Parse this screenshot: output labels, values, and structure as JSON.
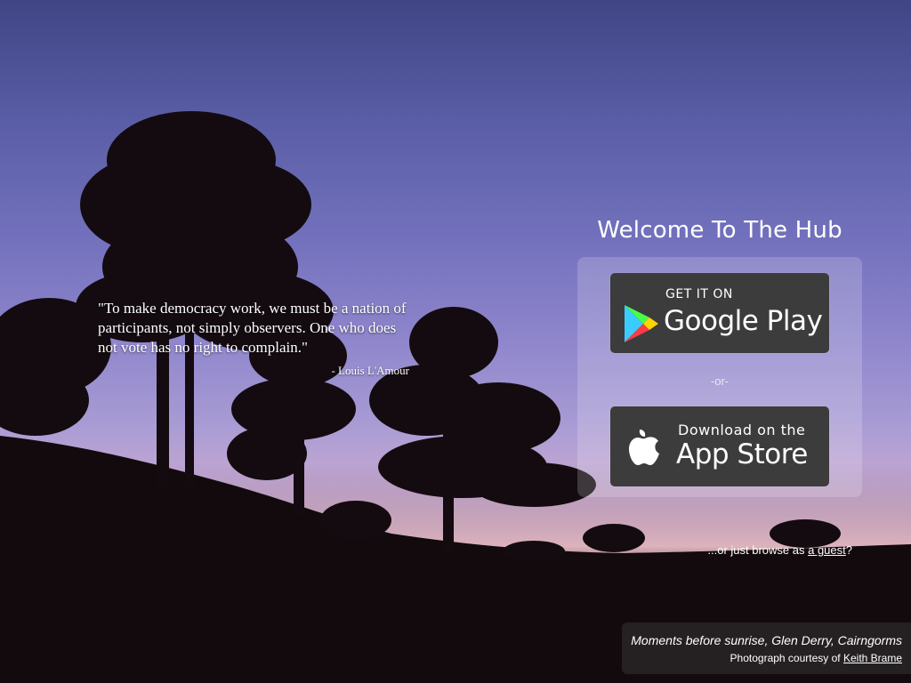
{
  "quote": {
    "text": "\"To make democracy work, we must be a nation of participants, not simply observers. One who does not vote has no right to complain.\"",
    "author": "- Louis L'Amour"
  },
  "welcome": {
    "title": "Welcome To The Hub"
  },
  "stores": {
    "google_small": "GET IT ON",
    "google_big": "Google Play",
    "or_text": "-or-",
    "apple_small": "Download on the",
    "apple_big": "App Store"
  },
  "guest": {
    "prefix": "...or just browse as ",
    "link": "a guest",
    "suffix": "?"
  },
  "photo_caption": {
    "title": "Moments before sunrise, Glen Derry, Cairngorms",
    "credit_prefix": "Photograph courtesy of ",
    "credit_name": "Keith Brame"
  },
  "icons": {
    "play": "google-play-icon",
    "apple": "apple-icon"
  },
  "colors": {
    "sky_top": "#3f4585",
    "sky_mid": "#8f86cc",
    "horizon": "#e2b8c6",
    "badge": "#3c3c3c"
  }
}
